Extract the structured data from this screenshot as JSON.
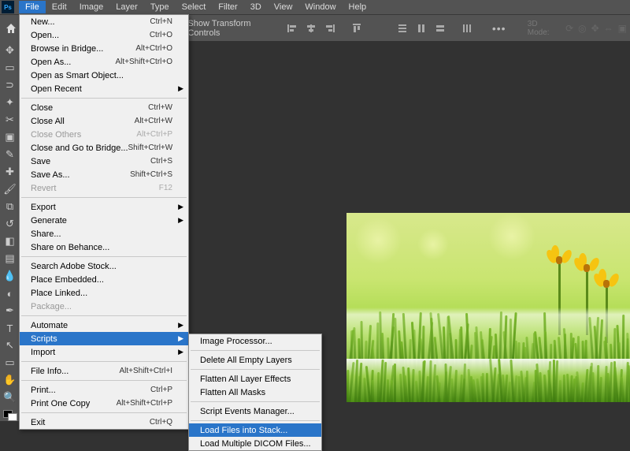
{
  "app": {
    "logo": "Ps"
  },
  "menubar": [
    "File",
    "Edit",
    "Image",
    "Layer",
    "Type",
    "Select",
    "Filter",
    "3D",
    "View",
    "Window",
    "Help"
  ],
  "menubar_active": 0,
  "options": {
    "show_transform_label": "Show Transform Controls",
    "mode3d_label": "3D Mode:"
  },
  "file_menu": [
    [
      {
        "label": "New...",
        "shortcut": "Ctrl+N"
      },
      {
        "label": "Open...",
        "shortcut": "Ctrl+O"
      },
      {
        "label": "Browse in Bridge...",
        "shortcut": "Alt+Ctrl+O"
      },
      {
        "label": "Open As...",
        "shortcut": "Alt+Shift+Ctrl+O"
      },
      {
        "label": "Open as Smart Object..."
      },
      {
        "label": "Open Recent",
        "submenu": true
      }
    ],
    [
      {
        "label": "Close",
        "shortcut": "Ctrl+W"
      },
      {
        "label": "Close All",
        "shortcut": "Alt+Ctrl+W"
      },
      {
        "label": "Close Others",
        "shortcut": "Alt+Ctrl+P",
        "disabled": true
      },
      {
        "label": "Close and Go to Bridge...",
        "shortcut": "Shift+Ctrl+W"
      },
      {
        "label": "Save",
        "shortcut": "Ctrl+S"
      },
      {
        "label": "Save As...",
        "shortcut": "Shift+Ctrl+S"
      },
      {
        "label": "Revert",
        "shortcut": "F12",
        "disabled": true
      }
    ],
    [
      {
        "label": "Export",
        "submenu": true
      },
      {
        "label": "Generate",
        "submenu": true
      },
      {
        "label": "Share..."
      },
      {
        "label": "Share on Behance..."
      }
    ],
    [
      {
        "label": "Search Adobe Stock..."
      },
      {
        "label": "Place Embedded..."
      },
      {
        "label": "Place Linked..."
      },
      {
        "label": "Package...",
        "disabled": true
      }
    ],
    [
      {
        "label": "Automate",
        "submenu": true
      },
      {
        "label": "Scripts",
        "submenu": true,
        "highlight": true
      },
      {
        "label": "Import",
        "submenu": true
      }
    ],
    [
      {
        "label": "File Info...",
        "shortcut": "Alt+Shift+Ctrl+I"
      }
    ],
    [
      {
        "label": "Print...",
        "shortcut": "Ctrl+P"
      },
      {
        "label": "Print One Copy",
        "shortcut": "Alt+Shift+Ctrl+P"
      }
    ],
    [
      {
        "label": "Exit",
        "shortcut": "Ctrl+Q"
      }
    ]
  ],
  "scripts_menu": [
    [
      {
        "label": "Image Processor..."
      }
    ],
    [
      {
        "label": "Delete All Empty Layers"
      }
    ],
    [
      {
        "label": "Flatten All Layer Effects"
      },
      {
        "label": "Flatten All Masks"
      }
    ],
    [
      {
        "label": "Script Events Manager..."
      }
    ],
    [
      {
        "label": "Load Files into Stack...",
        "highlight": true
      },
      {
        "label": "Load Multiple DICOM Files...",
        "clipped": true
      }
    ]
  ],
  "tools": [
    "move",
    "marquee",
    "lasso",
    "wand",
    "crop",
    "frame",
    "eyedrop",
    "heal",
    "brush",
    "stamp",
    "history",
    "eraser",
    "gradient",
    "blur",
    "dodge",
    "pen",
    "type",
    "path",
    "rect",
    "hand",
    "zoom"
  ]
}
